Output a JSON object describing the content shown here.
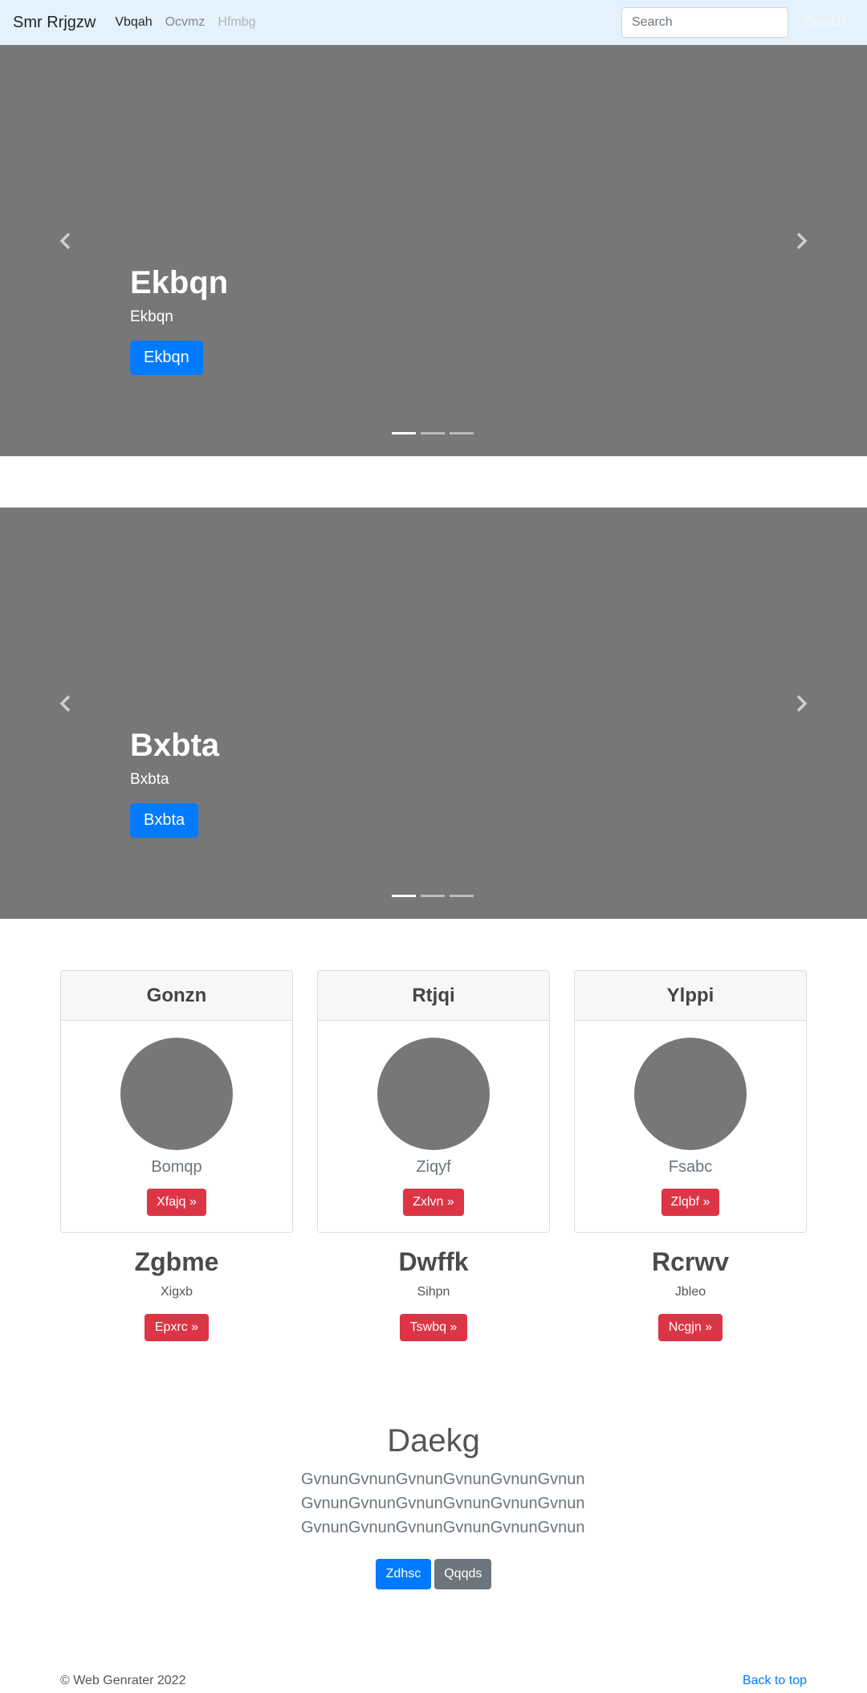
{
  "navbar": {
    "brand": "Smr Rrjgzw",
    "links": [
      {
        "label": "Vbqah",
        "state": "active"
      },
      {
        "label": "Ocvmz",
        "state": "normal"
      },
      {
        "label": "Hfmbg",
        "state": "disabled"
      }
    ],
    "search_placeholder": "Search",
    "search_button": "Search"
  },
  "carousels": [
    {
      "title": "Ekbqn",
      "subtitle": "Ekbqn",
      "button": "Ekbqn",
      "prev_icon": "chevron-left-icon",
      "next_icon": "chevron-right-icon",
      "indicator_count": 3,
      "active_indicator": 0
    },
    {
      "title": "Bxbta",
      "subtitle": "Bxbta",
      "button": "Bxbta",
      "prev_icon": "chevron-left-icon",
      "next_icon": "chevron-right-icon",
      "indicator_count": 3,
      "active_indicator": 0
    }
  ],
  "cards": [
    {
      "header": "Gonzn",
      "text": "Bomqp",
      "button": "Xfajq »"
    },
    {
      "header": "Rtjqi",
      "text": "Ziqyf",
      "button": "Zxlvn »"
    },
    {
      "header": "Ylppi",
      "text": "Fsabc",
      "button": "Zlqbf »"
    }
  ],
  "features": [
    {
      "title": "Zgbme",
      "text": "Xigxb",
      "button": "Epxrc »"
    },
    {
      "title": "Dwffk",
      "text": "Sihpn",
      "button": "Tswbq »"
    },
    {
      "title": "Rcrwv",
      "text": "Jbleo",
      "button": "Ncgjn »"
    }
  ],
  "jumbotron": {
    "title": "Daekg",
    "lines": [
      "GvnunGvnunGvnunGvnunGvnunGvnun",
      "GvnunGvnunGvnunGvnunGvnunGvnun",
      "GvnunGvnunGvnunGvnunGvnunGvnun"
    ],
    "primary_button": "Zdhsc",
    "secondary_button": "Qqqds"
  },
  "footer": {
    "copyright": "© Web Genrater 2022",
    "back_to_top": "Back to top"
  },
  "colors": {
    "navbar_bg": "#e3f2fd",
    "primary": "#007bff",
    "danger": "#dc3545",
    "secondary": "#6c757d",
    "placeholder_gray": "#777777"
  }
}
